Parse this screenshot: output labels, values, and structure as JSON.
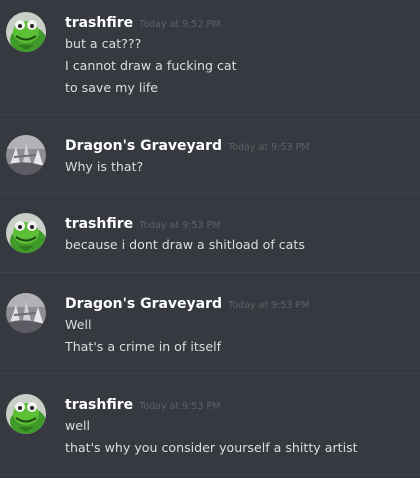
{
  "messages": [
    {
      "author": "trashfire",
      "avatar": "kermit-avatar-icon",
      "timestamp": "Today at 9:52 PM",
      "lines": [
        "but a cat???",
        "I cannot draw a fucking cat",
        "to save my life"
      ]
    },
    {
      "author": "Dragon's Graveyard",
      "avatar": "graveyard-avatar-icon",
      "timestamp": "Today at 9:53 PM",
      "lines": [
        "Why is that?"
      ]
    },
    {
      "author": "trashfire",
      "avatar": "kermit-avatar-icon",
      "timestamp": "Today at 9:53 PM",
      "lines": [
        "because i dont draw a shitload of cats"
      ]
    },
    {
      "author": "Dragon's Graveyard",
      "avatar": "graveyard-avatar-icon",
      "timestamp": "Today at 9:53 PM",
      "lines": [
        "Well",
        "That's a crime in of itself"
      ]
    },
    {
      "author": "trashfire",
      "avatar": "kermit-avatar-icon",
      "timestamp": "Today at 9:53 PM",
      "lines": [
        "well",
        "that's why you consider yourself a shitty artist"
      ]
    }
  ],
  "colors": {
    "background": "#36393f",
    "divider": "#3f4248",
    "username": "#ffffff",
    "message_text": "#dcddde",
    "timestamp": "#5d6167"
  }
}
